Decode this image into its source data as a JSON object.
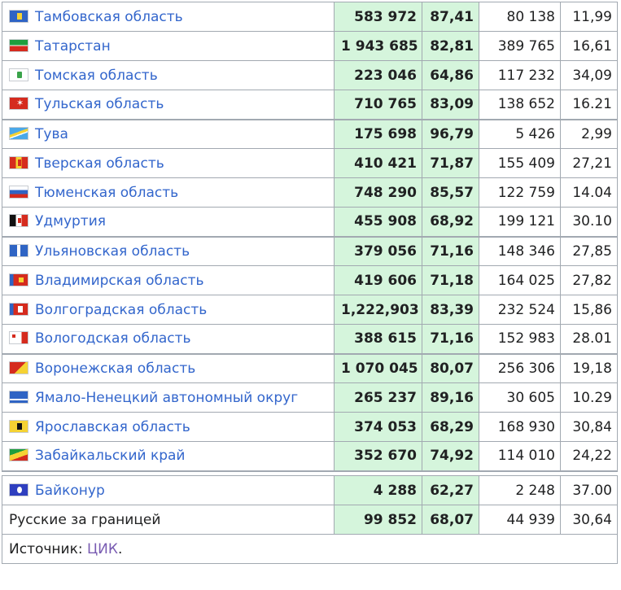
{
  "rows": [
    {
      "name": "Тамбовская область",
      "flag": "tambov-flag-icon",
      "link": true,
      "v1": "583 972",
      "p1": "87,41",
      "v2": "80 138",
      "p2": "11,99"
    },
    {
      "name": "Татарстан",
      "flag": "tatarstan-flag-icon",
      "link": true,
      "v1": "1 943 685",
      "p1": "82,81",
      "v2": "389 765",
      "p2": "16,61"
    },
    {
      "name": "Томская область",
      "flag": "tomsk-flag-icon",
      "link": true,
      "v1": "223 046",
      "p1": "64,86",
      "v2": "117 232",
      "p2": "34,09"
    },
    {
      "name": "Тульская область",
      "flag": "tula-flag-icon",
      "link": true,
      "v1": "710 765",
      "p1": "83,09",
      "v2": "138 652",
      "p2": "16.21"
    },
    {
      "name": "Тува",
      "flag": "tuva-flag-icon",
      "link": true,
      "v1": "175 698",
      "p1": "96,79",
      "v2": "5 426",
      "p2": "2,99"
    },
    {
      "name": "Тверская область",
      "flag": "tver-flag-icon",
      "link": true,
      "v1": "410 421",
      "p1": "71,87",
      "v2": "155 409",
      "p2": "27,21"
    },
    {
      "name": "Тюменская область",
      "flag": "tyumen-flag-icon",
      "link": true,
      "v1": "748 290",
      "p1": "85,57",
      "v2": "122 759",
      "p2": "14.04"
    },
    {
      "name": "Удмуртия",
      "flag": "udmurtia-flag-icon",
      "link": true,
      "v1": "455 908",
      "p1": "68,92",
      "v2": "199 121",
      "p2": "30.10"
    },
    {
      "name": "Ульяновская область",
      "flag": "ulyanovsk-flag-icon",
      "link": true,
      "v1": "379 056",
      "p1": "71,16",
      "v2": "148 346",
      "p2": "27,85"
    },
    {
      "name": "Владимирская область",
      "flag": "vladimir-flag-icon",
      "link": true,
      "v1": "419 606",
      "p1": "71,18",
      "v2": "164 025",
      "p2": "27,82"
    },
    {
      "name": "Волгоградская область",
      "flag": "volgograd-flag-icon",
      "link": true,
      "v1": "1,222,903",
      "p1": "83,39",
      "v2": "232 524",
      "p2": "15,86"
    },
    {
      "name": "Вологодская область",
      "flag": "vologda-flag-icon",
      "link": true,
      "v1": "388 615",
      "p1": "71,16",
      "v2": "152 983",
      "p2": "28.01"
    },
    {
      "name": "Воронежская область",
      "flag": "voronezh-flag-icon",
      "link": true,
      "v1": "1 070 045",
      "p1": "80,07",
      "v2": "256 306",
      "p2": "19,18"
    },
    {
      "name": "Ямало-Ненецкий автономный округ",
      "flag": "yamalo-nenets-flag-icon",
      "link": true,
      "v1": "265 237",
      "p1": "89,16",
      "v2": "30 605",
      "p2": "10.29"
    },
    {
      "name": "Ярославская область",
      "flag": "yaroslavl-flag-icon",
      "link": true,
      "v1": "374 053",
      "p1": "68,29",
      "v2": "168 930",
      "p2": "30,84"
    },
    {
      "name": "Забайкальский край",
      "flag": "zabaykalsky-flag-icon",
      "link": true,
      "v1": "352 670",
      "p1": "74,92",
      "v2": "114 010",
      "p2": "24,22"
    },
    {
      "name": "Байконур",
      "flag": "baikonur-flag-icon",
      "link": true,
      "v1": "4 288",
      "p1": "62,27",
      "v2": "2 248",
      "p2": "37.00"
    },
    {
      "name": "Русские за границей",
      "flag": "",
      "link": false,
      "v1": "99 852",
      "p1": "68,07",
      "v2": "44 939",
      "p2": "30,64"
    }
  ],
  "source": {
    "prefix": "Источник: ",
    "link": "ЦИК",
    "suffix": "."
  },
  "colors": {
    "link": "#3366cc",
    "visited": "#795cb2",
    "green_cell": "#d5f5dc",
    "border": "#a2a9b1"
  }
}
